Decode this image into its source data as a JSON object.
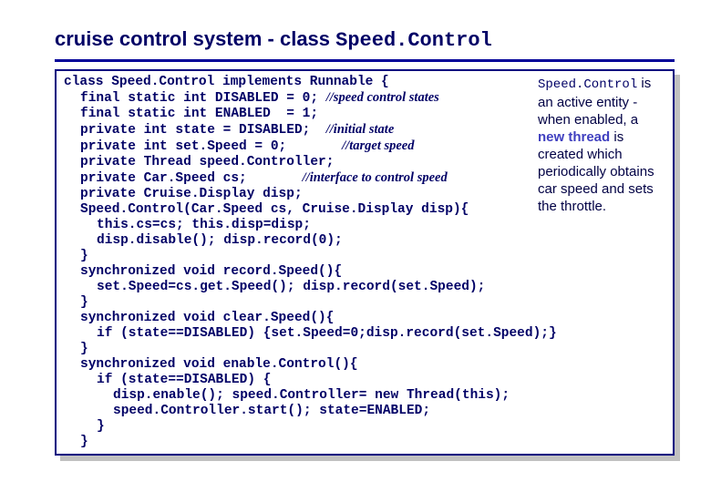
{
  "title": {
    "text_part": "cruise control system - class ",
    "mono_part": "Speed.Control"
  },
  "code": {
    "l1_a": "class Speed.Control implements Runnable {",
    "l2_a": "final static int DISABLED = 0; ",
    "l2_c": "//speed control states",
    "l3_a": "final static int ENABLED  = 1;",
    "l4_a": "private int state = DISABLED;  ",
    "l4_c": "//initial state",
    "l5_a": "private int set.Speed = 0;       ",
    "l5_c": "//target speed",
    "l6_a": "private Thread speed.Controller;",
    "l7_a": "private Car.Speed cs;       ",
    "l7_c": "//interface to control speed",
    "l8_a": "private Cruise.Display disp;",
    "l9_a": "Speed.Control(Car.Speed cs, Cruise.Display disp){",
    "l10_a": "this.cs=cs; this.disp=disp;",
    "l11_a": "disp.disable(); disp.record(0);",
    "l12_a": "}",
    "l13_a": "synchronized void record.Speed(){",
    "l14_a": "set.Speed=cs.get.Speed(); disp.record(set.Speed);",
    "l15_a": "}",
    "l16_a": "synchronized void clear.Speed(){",
    "l17_a": "if (state==DISABLED) {set.Speed=0;disp.record(set.Speed);}",
    "l18_a": "}",
    "l19_a": "synchronized void enable.Control(){",
    "l20_a": "if (state==DISABLED) {",
    "l21_a": "disp.enable(); speed.Controller= new Thread(this);",
    "l22_a": "speed.Controller.start(); state=ENABLED;",
    "l23_a": "}",
    "l24_a": "}"
  },
  "sidenote": {
    "p1_mono": "Speed.Control",
    "p2": " is an active entity - when enabled, a ",
    "p2_em": "new thread",
    "p3": " is created which periodically obtains car speed and sets the throttle."
  },
  "chart_data": {
    "type": "table",
    "title": "Code listing: class Speed.Control",
    "rows": [
      "class Speed.Control implements Runnable {",
      "  final static int DISABLED = 0; //speed control states",
      "  final static int ENABLED  = 1;",
      "  private int state = DISABLED;  //initial state",
      "  private int set.Speed = 0;       //target speed",
      "  private Thread speed.Controller;",
      "  private Car.Speed cs;       //interface to control speed",
      "  private Cruise.Display disp;",
      "  Speed.Control(Car.Speed cs, Cruise.Display disp){",
      "    this.cs=cs; this.disp=disp;",
      "    disp.disable(); disp.record(0);",
      "  }",
      "  synchronized void record.Speed(){",
      "    set.Speed=cs.get.Speed(); disp.record(set.Speed);",
      "  }",
      "  synchronized void clear.Speed(){",
      "    if (state==DISABLED) {set.Speed=0;disp.record(set.Speed);}",
      "  }",
      "  synchronized void enable.Control(){",
      "    if (state==DISABLED) {",
      "      disp.enable(); speed.Controller= new Thread(this);",
      "      speed.Controller.start(); state=ENABLED;",
      "    }",
      "  }"
    ]
  }
}
